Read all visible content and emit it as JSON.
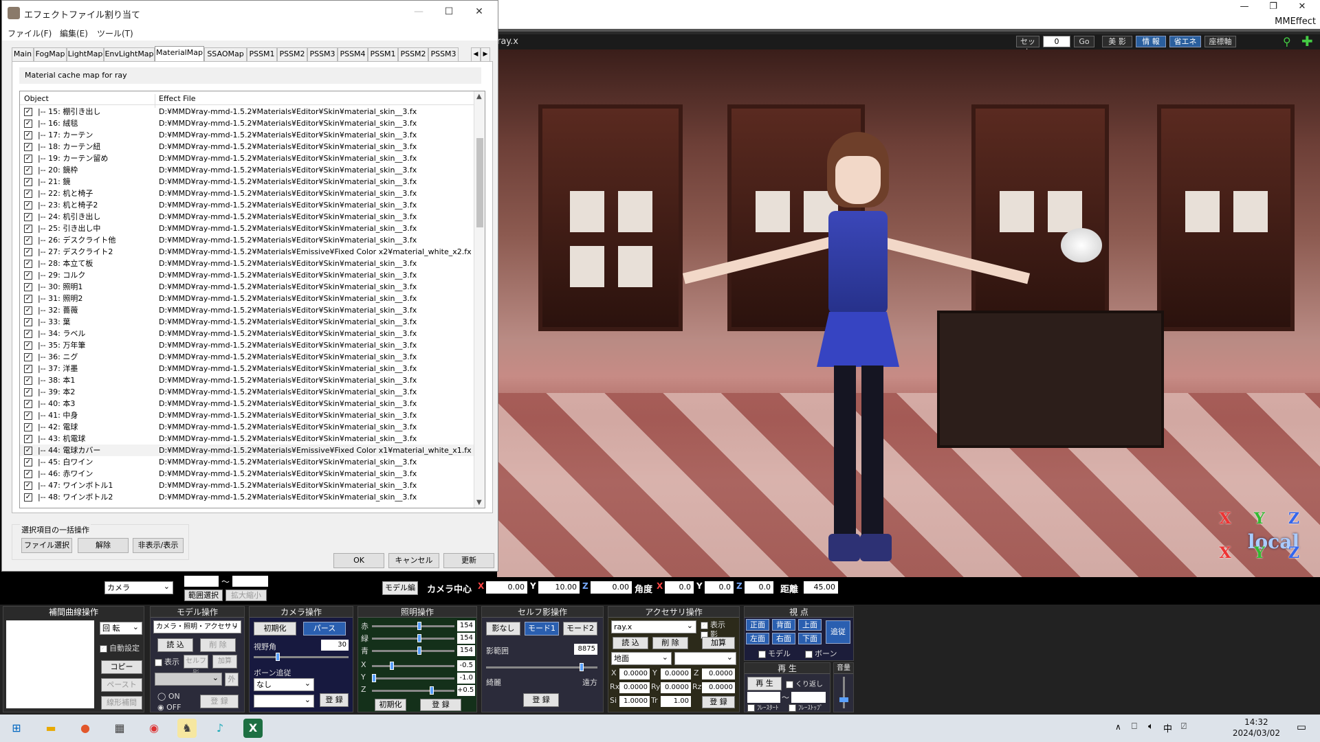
{
  "dialog": {
    "title": "エフェクトファイル割り当て",
    "menu": [
      "ファイル(F)",
      "編集(E)",
      "ツール(T)"
    ],
    "tabs": [
      "Main",
      "FogMap",
      "LightMap",
      "EnvLightMap",
      "MaterialMap",
      "SSAOMap",
      "PSSM1",
      "PSSM2",
      "PSSM3",
      "PSSM4",
      "PSSM1",
      "PSSM2",
      "PSSM3"
    ],
    "active_tab": "MaterialMap",
    "cache_title": "Material cache map for ray",
    "columns": {
      "object": "Object",
      "effect": "Effect File"
    },
    "rows": [
      {
        "object": "|-- 15: 棚引き出し",
        "effect": "D:¥MMD¥ray-mmd-1.5.2¥Materials¥Editor¥Skin¥material_skin__3.fx"
      },
      {
        "object": "|-- 16: 絨毯",
        "effect": "D:¥MMD¥ray-mmd-1.5.2¥Materials¥Editor¥Skin¥material_skin__3.fx"
      },
      {
        "object": "|-- 17: カーテン",
        "effect": "D:¥MMD¥ray-mmd-1.5.2¥Materials¥Editor¥Skin¥material_skin__3.fx"
      },
      {
        "object": "|-- 18: カーテン紐",
        "effect": "D:¥MMD¥ray-mmd-1.5.2¥Materials¥Editor¥Skin¥material_skin__3.fx"
      },
      {
        "object": "|-- 19: カーテン留め",
        "effect": "D:¥MMD¥ray-mmd-1.5.2¥Materials¥Editor¥Skin¥material_skin__3.fx"
      },
      {
        "object": "|-- 20: 鏡枠",
        "effect": "D:¥MMD¥ray-mmd-1.5.2¥Materials¥Editor¥Skin¥material_skin__3.fx"
      },
      {
        "object": "|-- 21: 鏡",
        "effect": "D:¥MMD¥ray-mmd-1.5.2¥Materials¥Editor¥Skin¥material_skin__3.fx"
      },
      {
        "object": "|-- 22: 机と椅子",
        "effect": "D:¥MMD¥ray-mmd-1.5.2¥Materials¥Editor¥Skin¥material_skin__3.fx"
      },
      {
        "object": "|-- 23: 机と椅子2",
        "effect": "D:¥MMD¥ray-mmd-1.5.2¥Materials¥Editor¥Skin¥material_skin__3.fx"
      },
      {
        "object": "|-- 24: 机引き出し",
        "effect": "D:¥MMD¥ray-mmd-1.5.2¥Materials¥Editor¥Skin¥material_skin__3.fx"
      },
      {
        "object": "|-- 25: 引き出し中",
        "effect": "D:¥MMD¥ray-mmd-1.5.2¥Materials¥Editor¥Skin¥material_skin__3.fx"
      },
      {
        "object": "|-- 26: デスクライト他",
        "effect": "D:¥MMD¥ray-mmd-1.5.2¥Materials¥Editor¥Skin¥material_skin__3.fx"
      },
      {
        "object": "|-- 27: デスクライト2",
        "effect": "D:¥MMD¥ray-mmd-1.5.2¥Materials¥Emissive¥Fixed Color x2¥material_white_x2.fx"
      },
      {
        "object": "|-- 28: 本立て板",
        "effect": "D:¥MMD¥ray-mmd-1.5.2¥Materials¥Editor¥Skin¥material_skin__3.fx"
      },
      {
        "object": "|-- 29: コルク",
        "effect": "D:¥MMD¥ray-mmd-1.5.2¥Materials¥Editor¥Skin¥material_skin__3.fx"
      },
      {
        "object": "|-- 30: 照明1",
        "effect": "D:¥MMD¥ray-mmd-1.5.2¥Materials¥Editor¥Skin¥material_skin__3.fx"
      },
      {
        "object": "|-- 31: 照明2",
        "effect": "D:¥MMD¥ray-mmd-1.5.2¥Materials¥Editor¥Skin¥material_skin__3.fx"
      },
      {
        "object": "|-- 32: 薔薇",
        "effect": "D:¥MMD¥ray-mmd-1.5.2¥Materials¥Editor¥Skin¥material_skin__3.fx"
      },
      {
        "object": "|-- 33: 葉",
        "effect": "D:¥MMD¥ray-mmd-1.5.2¥Materials¥Editor¥Skin¥material_skin__3.fx"
      },
      {
        "object": "|-- 34: ラベル",
        "effect": "D:¥MMD¥ray-mmd-1.5.2¥Materials¥Editor¥Skin¥material_skin__3.fx"
      },
      {
        "object": "|-- 35: 万年筆",
        "effect": "D:¥MMD¥ray-mmd-1.5.2¥Materials¥Editor¥Skin¥material_skin__3.fx"
      },
      {
        "object": "|-- 36: ニグ",
        "effect": "D:¥MMD¥ray-mmd-1.5.2¥Materials¥Editor¥Skin¥material_skin__3.fx"
      },
      {
        "object": "|-- 37: 洋墨",
        "effect": "D:¥MMD¥ray-mmd-1.5.2¥Materials¥Editor¥Skin¥material_skin__3.fx"
      },
      {
        "object": "|-- 38: 本1",
        "effect": "D:¥MMD¥ray-mmd-1.5.2¥Materials¥Editor¥Skin¥material_skin__3.fx"
      },
      {
        "object": "|-- 39: 本2",
        "effect": "D:¥MMD¥ray-mmd-1.5.2¥Materials¥Editor¥Skin¥material_skin__3.fx"
      },
      {
        "object": "|-- 40: 本3",
        "effect": "D:¥MMD¥ray-mmd-1.5.2¥Materials¥Editor¥Skin¥material_skin__3.fx"
      },
      {
        "object": "|-- 41: 中身",
        "effect": "D:¥MMD¥ray-mmd-1.5.2¥Materials¥Editor¥Skin¥material_skin__3.fx"
      },
      {
        "object": "|-- 42: 電球",
        "effect": "D:¥MMD¥ray-mmd-1.5.2¥Materials¥Editor¥Skin¥material_skin__3.fx"
      },
      {
        "object": "|-- 43: 机電球",
        "effect": "D:¥MMD¥ray-mmd-1.5.2¥Materials¥Editor¥Skin¥material_skin__3.fx"
      },
      {
        "object": "|-- 44: 電球カバー",
        "effect": "D:¥MMD¥ray-mmd-1.5.2¥Materials¥Emissive¥Fixed Color x1¥material_white_x1.fx"
      },
      {
        "object": "|-- 45: 白ワイン",
        "effect": "D:¥MMD¥ray-mmd-1.5.2¥Materials¥Editor¥Skin¥material_skin__3.fx"
      },
      {
        "object": "|-- 46: 赤ワイン",
        "effect": "D:¥MMD¥ray-mmd-1.5.2¥Materials¥Editor¥Skin¥material_skin__3.fx"
      },
      {
        "object": "|-- 47: ワインボトル1",
        "effect": "D:¥MMD¥ray-mmd-1.5.2¥Materials¥Editor¥Skin¥material_skin__3.fx"
      },
      {
        "object": "|-- 48: ワインボトル2",
        "effect": "D:¥MMD¥ray-mmd-1.5.2¥Materials¥Editor¥Skin¥material_skin__3.fx"
      }
    ],
    "batch_label": "選択項目の一括操作",
    "batch_buttons": [
      "ファイル選択",
      "解除",
      "非表示/表示"
    ],
    "ok": "OK",
    "cancel": "キャンセル",
    "update": "更新"
  },
  "mmd": {
    "app_name": "MMEffect",
    "viewport_label": "ray.x",
    "top_buttons": {
      "set": "セット",
      "frame": "0",
      "go": "Go",
      "beauty": "美 影",
      "info": "情 報",
      "save": "省エネ",
      "axis": "座標軸"
    },
    "local_label": "local",
    "axis_x": "X",
    "axis_y": "Y",
    "axis_z": "Z",
    "camera_bar": {
      "model_edit": "モデル編",
      "camera_center": "カメラ中心",
      "x": "0.00",
      "y": "10.00",
      "z": "0.00",
      "angle": "角度",
      "ax": "0.0",
      "ay": "0.0",
      "az": "0.0",
      "distance": "距離",
      "dist_value": "45.00"
    },
    "left_strip": {
      "camera_select": "カメラ",
      "range_select": "範囲選択",
      "expand": "拡大縮小",
      "tilde": "〜"
    }
  },
  "panels": {
    "interp": {
      "title": "補間曲線操作",
      "rotate": "回 転",
      "auto": "自動設定",
      "copy": "コピー",
      "paste": "ペースト",
      "linear": "線形補間"
    },
    "model": {
      "title": "モデル操作",
      "select": "カメラ・照明・アクセサリ",
      "load": "読 込",
      "delete": "削 除",
      "show": "表示",
      "self_shadow": "セルフ影",
      "add": "加算",
      "outer": "外",
      "on": "ON",
      "off": "OFF",
      "register": "登 録"
    },
    "camera": {
      "title": "カメラ操作",
      "init": "初期化",
      "perspective": "パース",
      "fov_label": "視野角",
      "fov": "30",
      "bone_follow": "ボーン追従",
      "bone_none": "なし",
      "register": "登 録"
    },
    "light": {
      "title": "照明操作",
      "red": "赤",
      "green": "緑",
      "blue": "青",
      "r": "154",
      "g": "154",
      "b": "154",
      "x": "X",
      "y": "Y",
      "z": "Z",
      "lx": "-0.5",
      "ly": "-1.0",
      "lz": "+0.5",
      "init": "初期化",
      "register": "登 録"
    },
    "shadow": {
      "title": "セルフ影操作",
      "none": "影なし",
      "mode1": "モード1",
      "mode2": "モード2",
      "range_label": "影範囲",
      "range": "8875",
      "near": "綺麗",
      "far": "遠方",
      "register": "登 録"
    },
    "accessory": {
      "title": "アクセサリ操作",
      "select": "ray.x",
      "show": "表示",
      "shadow": "影",
      "load": "読 込",
      "delete": "削 除",
      "add": "加算",
      "ground": "地面",
      "x": "0.0000",
      "y": "0.0000",
      "z": "0.0000",
      "rx": "0.0000",
      "ry": "0.0000",
      "rz": "0.0000",
      "si": "1.0000",
      "tr": "1.00",
      "register": "登 録"
    },
    "view": {
      "title": "視 点",
      "front": "正面",
      "back": "背面",
      "top": "上面",
      "left": "左面",
      "right": "右面",
      "bottom": "下面",
      "follow": "追従",
      "model": "モデル",
      "bone": "ボーン"
    },
    "play": {
      "title": "再 生",
      "play": "再 生",
      "repeat": "くり返し",
      "start": "ﾌﾚｰｽﾀｰﾄ",
      "stop": "ﾌﾚｰｽﾄｯﾌﾟ",
      "tilde": "〜"
    },
    "volume": {
      "title": "音量"
    }
  },
  "taskbar": {
    "time": "14:32",
    "date": "2024/03/02",
    "ime": "中"
  }
}
